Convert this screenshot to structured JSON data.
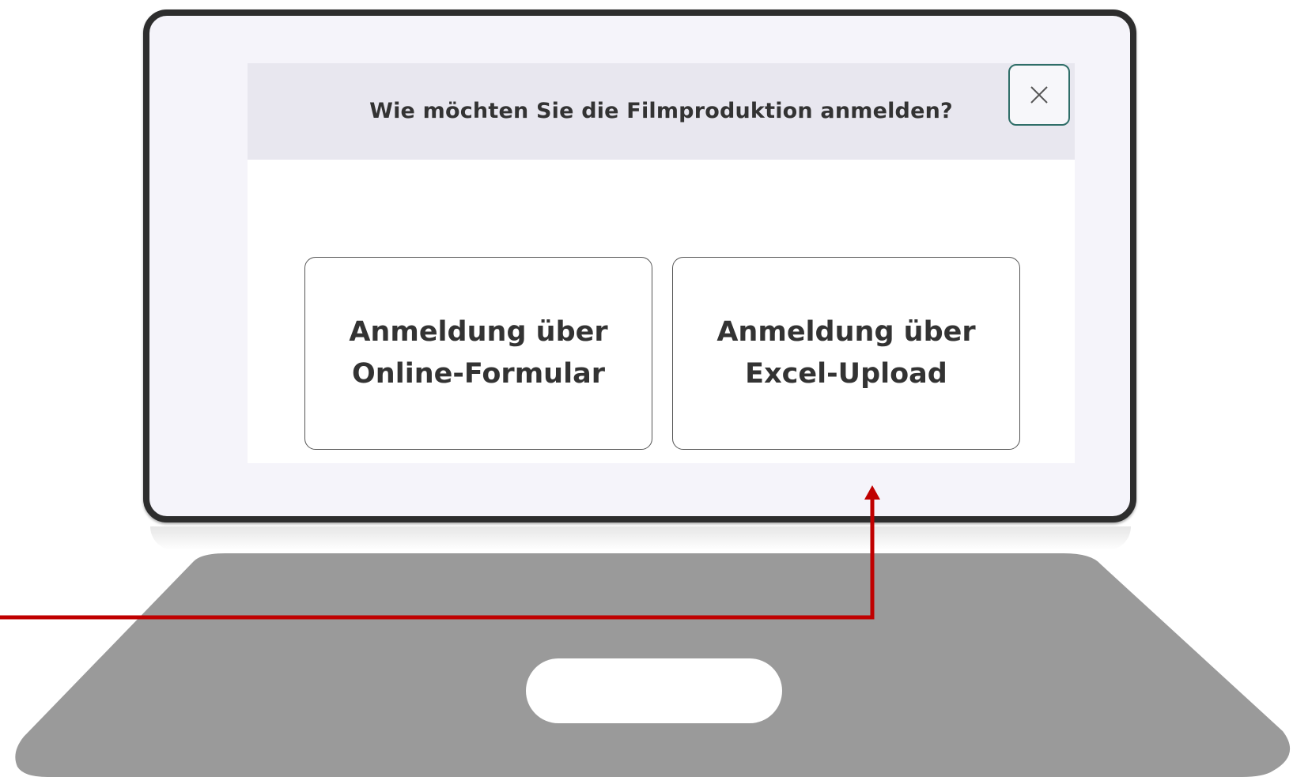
{
  "dialog": {
    "title": "Wie möchten Sie die Filmproduktion anmelden?",
    "close_icon": "close-icon",
    "options": [
      {
        "line1": "Anmeldung über",
        "line2": "Online-Formular"
      },
      {
        "line1": "Anmeldung über",
        "line2": "Excel-Upload"
      }
    ]
  },
  "colors": {
    "screen_bezel": "#2d2d2d",
    "header_background": "#e8e7ef",
    "close_button_border": "#2f6e68",
    "laptop_base": "#9a9a9a",
    "annotation_arrow": "#c00000"
  },
  "annotation": {
    "type": "arrow",
    "points_to": "Excel-Upload"
  }
}
